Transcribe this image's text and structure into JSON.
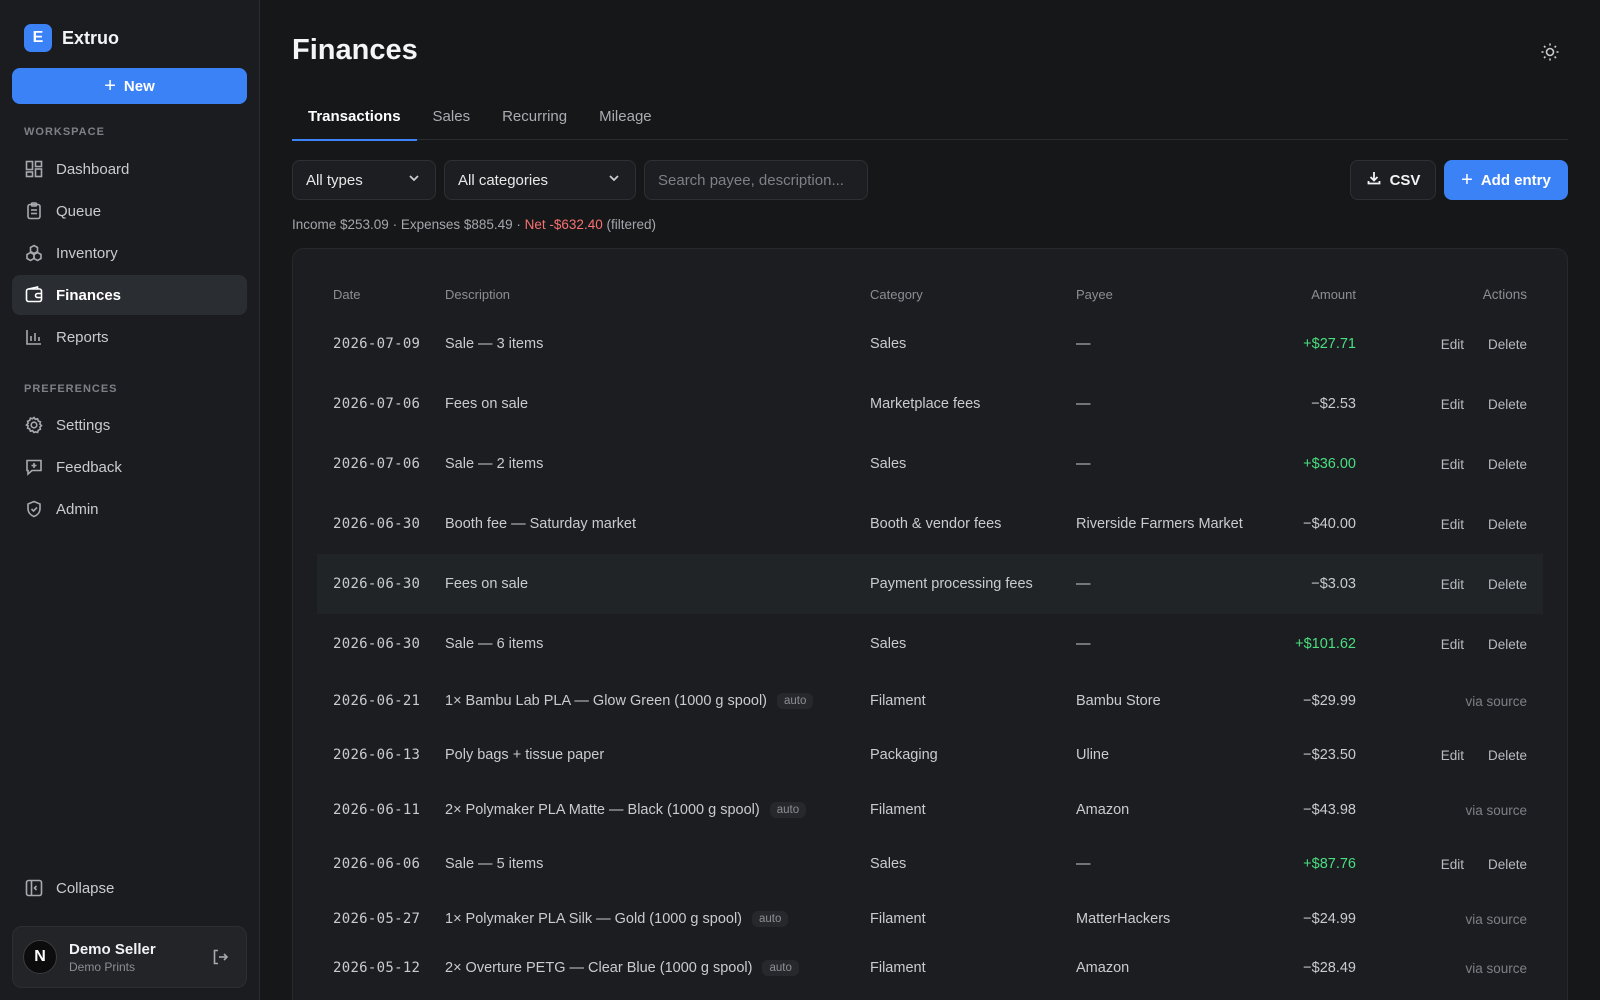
{
  "sidebar": {
    "brand": {
      "logo_letter": "E",
      "name": "Extruo"
    },
    "new_label": "New",
    "workspace_label": "WORKSPACE",
    "preferences_label": "PREFERENCES",
    "workspace_items": [
      {
        "label": "Dashboard",
        "icon": "dashboard-icon"
      },
      {
        "label": "Queue",
        "icon": "clipboard-icon"
      },
      {
        "label": "Inventory",
        "icon": "boxes-icon"
      },
      {
        "label": "Finances",
        "icon": "wallet-icon",
        "active": true
      },
      {
        "label": "Reports",
        "icon": "bar-chart-icon"
      }
    ],
    "preference_items": [
      {
        "label": "Settings",
        "icon": "gear-icon"
      },
      {
        "label": "Feedback",
        "icon": "feedback-icon"
      },
      {
        "label": "Admin",
        "icon": "shield-icon"
      }
    ],
    "collapse_label": "Collapse",
    "user": {
      "avatar_letter": "N",
      "name": "Demo Seller",
      "org": "Demo Prints"
    }
  },
  "header": {
    "title": "Finances"
  },
  "tabs": [
    {
      "label": "Transactions",
      "active": true
    },
    {
      "label": "Sales"
    },
    {
      "label": "Recurring"
    },
    {
      "label": "Mileage"
    }
  ],
  "filters": {
    "type_value": "All types",
    "category_value": "All categories",
    "search_placeholder": "Search payee, description...",
    "csv_label": "CSV",
    "add_label": "Add entry"
  },
  "summary": {
    "prefix": "Income $253.09 · Expenses $885.49 · ",
    "net_label": "Net -$632.40",
    "suffix": " (filtered)"
  },
  "table": {
    "headers": {
      "date": "Date",
      "description": "Description",
      "category": "Category",
      "payee": "Payee",
      "amount": "Amount",
      "actions": "Actions"
    },
    "edit_label": "Edit",
    "delete_label": "Delete",
    "via_label": "via source",
    "rows": [
      {
        "date": "2026-07-09",
        "description": "Sale — 3 items",
        "badge": "",
        "category": "Sales",
        "payee": "—",
        "amount": "+$27.71",
        "positive": true,
        "editable": true
      },
      {
        "date": "2026-07-06",
        "description": "Fees on sale",
        "badge": "",
        "category": "Marketplace fees",
        "payee": "—",
        "amount": "−$2.53",
        "positive": false,
        "editable": true
      },
      {
        "date": "2026-07-06",
        "description": "Sale — 2 items",
        "badge": "",
        "category": "Sales",
        "payee": "—",
        "amount": "+$36.00",
        "positive": true,
        "editable": true
      },
      {
        "date": "2026-06-30",
        "description": "Booth fee — Saturday market",
        "badge": "",
        "category": "Booth & vendor fees",
        "payee": "Riverside Farmers Market",
        "amount": "−$40.00",
        "positive": false,
        "editable": true
      },
      {
        "date": "2026-06-30",
        "description": "Fees on sale",
        "badge": "",
        "category": "Payment processing fees",
        "payee": "—",
        "amount": "−$3.03",
        "positive": false,
        "editable": true,
        "highlighted": true
      },
      {
        "date": "2026-06-30",
        "description": "Sale — 6 items",
        "badge": "",
        "category": "Sales",
        "payee": "—",
        "amount": "+$101.62",
        "positive": true,
        "editable": true
      },
      {
        "date": "2026-06-21",
        "description": "1× Bambu Lab PLA — Glow Green (1000 g spool)",
        "badge": "auto",
        "category": "Filament",
        "payee": "Bambu Store",
        "amount": "−$29.99",
        "positive": false,
        "editable": false
      },
      {
        "date": "2026-06-13",
        "description": "Poly bags + tissue paper",
        "badge": "",
        "category": "Packaging",
        "payee": "Uline",
        "amount": "−$23.50",
        "positive": false,
        "editable": true
      },
      {
        "date": "2026-06-11",
        "description": "2× Polymaker PLA Matte — Black (1000 g spool)",
        "badge": "auto",
        "category": "Filament",
        "payee": "Amazon",
        "amount": "−$43.98",
        "positive": false,
        "editable": false
      },
      {
        "date": "2026-06-06",
        "description": "Sale — 5 items",
        "badge": "",
        "category": "Sales",
        "payee": "—",
        "amount": "+$87.76",
        "positive": true,
        "editable": true
      },
      {
        "date": "2026-05-27",
        "description": "1× Polymaker PLA Silk — Gold (1000 g spool)",
        "badge": "auto",
        "category": "Filament",
        "payee": "MatterHackers",
        "amount": "−$24.99",
        "positive": false,
        "editable": false
      },
      {
        "date": "2026-05-12",
        "description": "2× Overture PETG — Clear Blue (1000 g spool)",
        "badge": "auto",
        "category": "Filament",
        "payee": "Amazon",
        "amount": "−$28.49",
        "positive": false,
        "editable": false
      }
    ]
  },
  "colors": {
    "accent": "#3b82f6",
    "positive": "#4ade80",
    "negative": "#f87171"
  }
}
